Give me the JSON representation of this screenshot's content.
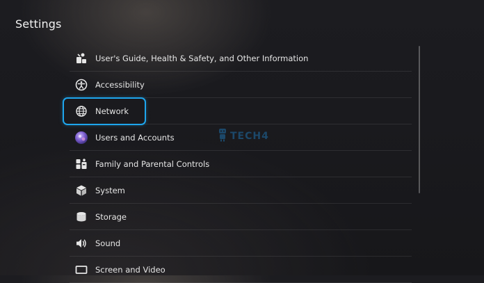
{
  "header": {
    "title": "Settings"
  },
  "menu": {
    "items": [
      {
        "label": "User's Guide, Health & Safety, and Other Information",
        "icon": "guide-icon"
      },
      {
        "label": "Accessibility",
        "icon": "accessibility-icon"
      },
      {
        "label": "Network",
        "icon": "globe-icon",
        "focused": true
      },
      {
        "label": "Users and Accounts",
        "icon": "user-avatar-icon"
      },
      {
        "label": "Family and Parental Controls",
        "icon": "family-icon"
      },
      {
        "label": "System",
        "icon": "cube-icon"
      },
      {
        "label": "Storage",
        "icon": "storage-icon"
      },
      {
        "label": "Sound",
        "icon": "speaker-icon"
      },
      {
        "label": "Screen and Video",
        "icon": "screen-icon"
      }
    ]
  },
  "watermark": {
    "text": "TECH4",
    "icon": "robot-icon"
  },
  "colors": {
    "focus": "#1ea6ee",
    "background": "#1a1a1e",
    "text": "#e6e6e6"
  }
}
